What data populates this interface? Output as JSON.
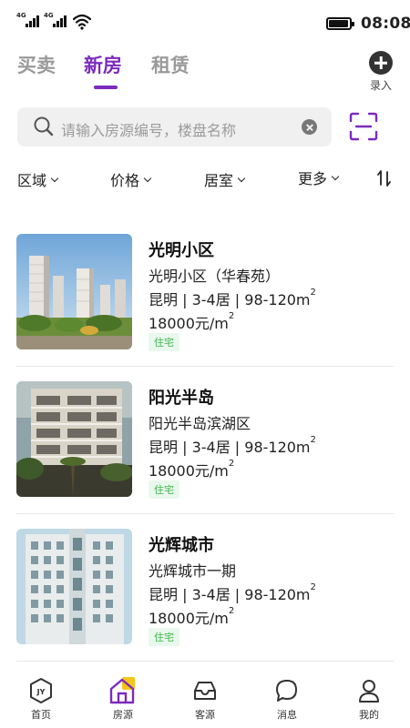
{
  "status_bar": {
    "signal_tag_1": "4G",
    "signal_tag_2": "4G",
    "time": "08:08"
  },
  "top_tabs": [
    {
      "label": "买卖",
      "active": false
    },
    {
      "label": "新房",
      "active": true
    },
    {
      "label": "租赁",
      "active": false
    }
  ],
  "add_button": {
    "label": "录入",
    "icon": "plus-circle-icon"
  },
  "search": {
    "placeholder": "请输入房源编号，楼盘名称",
    "icon": "search-icon"
  },
  "scan": {
    "icon": "scan-icon"
  },
  "filters": [
    {
      "label": "区域"
    },
    {
      "label": "价格"
    },
    {
      "label": "居室"
    },
    {
      "label": "更多"
    }
  ],
  "sort": {
    "icon": "sort-icon"
  },
  "listings": [
    {
      "name": "光明小区",
      "sub": "光明小区（华春苑）",
      "spec": "昆明 | 3-4居 | 98-120m",
      "spec_unit": "2",
      "price": "18000元/m",
      "price_unit": "2",
      "tag": "住宅"
    },
    {
      "name": "阳光半岛",
      "sub": "阳光半岛滨湖区",
      "spec": "昆明 | 3-4居 | 98-120m",
      "spec_unit": "2",
      "price": "18000元/m",
      "price_unit": "2",
      "tag": "住宅"
    },
    {
      "name": "光辉城市",
      "sub": "光辉城市一期",
      "spec": "昆明 | 3-4居 | 98-120m",
      "spec_unit": "2",
      "price": "18000元/m",
      "price_unit": "2",
      "tag": "住宅"
    }
  ],
  "bottom_nav": [
    {
      "label": "首页",
      "icon": "jy-home-icon",
      "active": false
    },
    {
      "label": "房源",
      "icon": "house-icon",
      "active": true
    },
    {
      "label": "客源",
      "icon": "inbox-icon",
      "active": false
    },
    {
      "label": "消息",
      "icon": "chat-icon",
      "active": false
    },
    {
      "label": "我的",
      "icon": "user-icon",
      "active": false
    }
  ],
  "colors": {
    "accent": "#7b2bbd",
    "tag_green": "#39b54a",
    "badge_yellow": "#f5c518"
  },
  "jy_logo_text": "JY"
}
